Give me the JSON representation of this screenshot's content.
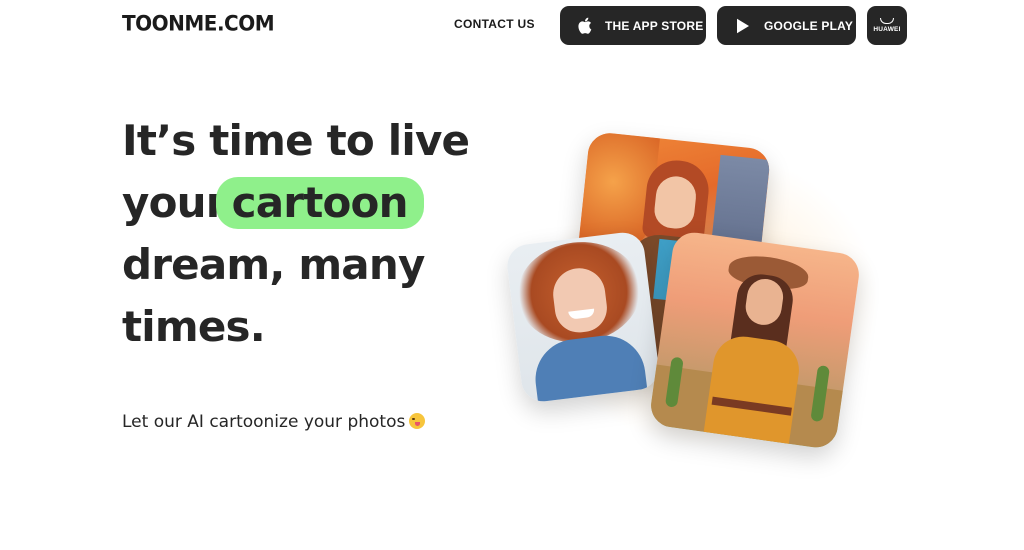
{
  "header": {
    "logo": "TOONME.COM",
    "contact_label": "CONTACT US",
    "app_store_label": "THE APP STORE",
    "google_play_label": "GOOGLE PLAY",
    "huawei_label": "HUAWEI"
  },
  "hero": {
    "line1": "It’s time to live",
    "line2_prefix": "your",
    "line2_highlight": "cartoon",
    "line3": "dream, many",
    "line4": "times.",
    "subtitle": "Let our AI cartoonize your photos"
  },
  "icons": {
    "apple": "apple-icon",
    "google_play": "play-icon",
    "huawei": "shopping-bag-icon",
    "emoji": "zany-face-emoji"
  },
  "colors": {
    "highlight": "#8ff08b",
    "button_bg": "#262626",
    "text": "#262626"
  }
}
